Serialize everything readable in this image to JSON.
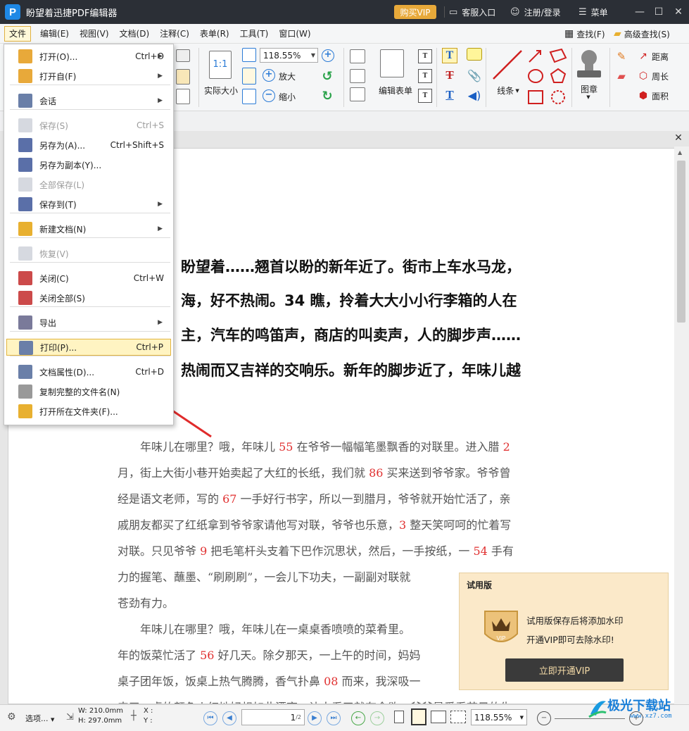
{
  "window": {
    "title": "盼望着迅捷PDF编辑器",
    "buy_vip": "购买VIP",
    "customer_service": "客服入口",
    "register_login": "注册/登录",
    "menu": "菜单"
  },
  "menubar": {
    "items": [
      "文件",
      "编辑(E)",
      "视图(V)",
      "文档(D)",
      "注释(C)",
      "表单(R)",
      "工具(T)",
      "窗口(W)"
    ],
    "find": "查找(F)",
    "advanced_find": "高级查找(S)"
  },
  "toolbar": {
    "zoom_value": "118.55%",
    "actual_size": "实际大小",
    "actual_size_icon": "1:1",
    "zoom_in": "放大",
    "zoom_out": "缩小",
    "edit_form": "编辑表单",
    "lines": "线条",
    "stamp": "图章",
    "distance": "距离",
    "perimeter": "周长",
    "area": "面积"
  },
  "file_menu": {
    "items": [
      {
        "label": "打开(O)...",
        "shortcut": "Ctrl+O",
        "submenu": true,
        "disabled": false
      },
      {
        "label": "打开自(F)",
        "shortcut": "",
        "submenu": true,
        "disabled": false
      },
      {
        "label": "会话",
        "shortcut": "",
        "submenu": true,
        "disabled": false
      },
      {
        "label": "保存(S)",
        "shortcut": "Ctrl+S",
        "submenu": false,
        "disabled": true
      },
      {
        "label": "另存为(A)...",
        "shortcut": "Ctrl+Shift+S",
        "submenu": false,
        "disabled": false
      },
      {
        "label": "另存为副本(Y)...",
        "shortcut": "",
        "submenu": false,
        "disabled": false
      },
      {
        "label": "全部保存(L)",
        "shortcut": "",
        "submenu": false,
        "disabled": true
      },
      {
        "label": "保存到(T)",
        "shortcut": "",
        "submenu": true,
        "disabled": false
      },
      {
        "label": "新建文档(N)",
        "shortcut": "",
        "submenu": true,
        "disabled": false
      },
      {
        "label": "恢复(V)",
        "shortcut": "",
        "submenu": false,
        "disabled": true
      },
      {
        "label": "关闭(C)",
        "shortcut": "Ctrl+W",
        "submenu": false,
        "disabled": false
      },
      {
        "label": "关闭全部(S)",
        "shortcut": "",
        "submenu": false,
        "disabled": false
      },
      {
        "label": "导出",
        "shortcut": "",
        "submenu": true,
        "disabled": false
      },
      {
        "label": "打印(P)...",
        "shortcut": "Ctrl+P",
        "submenu": false,
        "disabled": false
      },
      {
        "label": "文档属性(D)...",
        "shortcut": "Ctrl+D",
        "submenu": false,
        "disabled": false
      },
      {
        "label": "复制完整的文件名(N)",
        "shortcut": "",
        "submenu": false,
        "disabled": false
      },
      {
        "label": "打开所在文件夹(F)...",
        "shortcut": "",
        "submenu": false,
        "disabled": false
      }
    ]
  },
  "document": {
    "heading_lines": [
      "盼望着……翘首以盼的新年近了。街市上车水马龙，",
      "海，好不热闹。34 瞧，拎着大大小小行李箱的人在",
      "主，汽车的鸣笛声，商店的叫卖声，人的脚步声……",
      "热闹而又吉祥的交响乐。新年的脚步近了，年味儿越"
    ],
    "para1": [
      [
        "　　年味儿在哪里？哦，年味儿 ",
        "55",
        " 在爷爷一幅幅笔墨飘香的对联里。进入腊 ",
        "2",
        ""
      ],
      [
        "月，街上大街小巷开始卖起了大红的长纸，我们就 ",
        "86",
        " 买来送到爷爷家。爷爷曾"
      ],
      [
        "经是语文老师，写的 ",
        "67",
        " 一手好行书字，所以一到腊月，爷爷就开始忙活了，亲"
      ],
      [
        "戚朋友都买了红纸拿到爷爷家请他写对联，爷爷也乐意，",
        "3",
        " 整天笑呵呵的忙着写"
      ],
      [
        "对联。只见爷爷 ",
        "9",
        " 把毛笔杆头支着下巴作沉思状，然后，一手按纸，一 ",
        "54",
        " 手有"
      ],
      [
        "力的握笔、蘸墨、“刷刷刷”，一会儿下功夫，一副副对联就"
      ],
      [
        "苍劲有力。"
      ]
    ],
    "para2": [
      [
        "　　年味儿在哪里？哦，年味儿在一桌桌香喷喷的菜肴里。"
      ],
      [
        "年的饭菜忙活了 ",
        "56",
        " 好几天。除夕那天，一上午的时间，妈妈"
      ],
      [
        "桌子团年饭，饭桌上热气腾腾，香气扑鼻 ",
        "08",
        " 而来，我深吸一"
      ],
      [
        "来了，桌的颜色火红地好想如此漂亮，让人看了就有食欲，爷爷最爱看节目的生"
      ]
    ]
  },
  "vip_popup": {
    "title": "试用版",
    "line1": "试用版保存后将添加水印",
    "line2": "开通VIP即可去除水印!",
    "cta": "立即开通VIP",
    "badge_text": "VIP"
  },
  "statusbar": {
    "options": "选项...",
    "width": "W: 210.0mm",
    "height": "H: 297.0mm",
    "x": "X :",
    "y": "Y :",
    "page_current": "1",
    "page_total": "/2",
    "zoom": "118.55%"
  },
  "watermark": {
    "text": "极光下载站",
    "url": "www.xz7.com"
  },
  "colors": {
    "titlebar": "#2b2f36",
    "vip_gold": "#e8a93a",
    "highlight_number": "#e03030",
    "menu_highlight": "#fff4c2",
    "annotation_arrow": "#e02b2b"
  }
}
